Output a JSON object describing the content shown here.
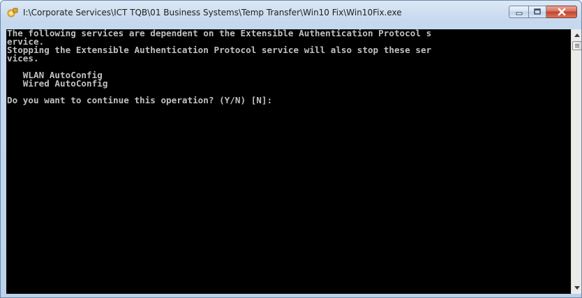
{
  "window": {
    "title": "I:\\Corporate Services\\ICT TQB\\01 Business Systems\\Temp Transfer\\Win10 Fix\\Win10Fix.exe",
    "icon": "cmd-app-icon",
    "caption_buttons": [
      "minimize",
      "maximize",
      "close"
    ]
  },
  "console": {
    "text": "The following services are dependent on the Extensible Authentication Protocol s\nervice.\nStopping the Extensible Authentication Protocol service will also stop these ser\nvices.\n\n   WLAN AutoConfig\n   Wired AutoConfig\n\nDo you want to continue this operation? (Y/N) [N]:",
    "foreground": "#c0c0c0",
    "background": "#000000"
  }
}
